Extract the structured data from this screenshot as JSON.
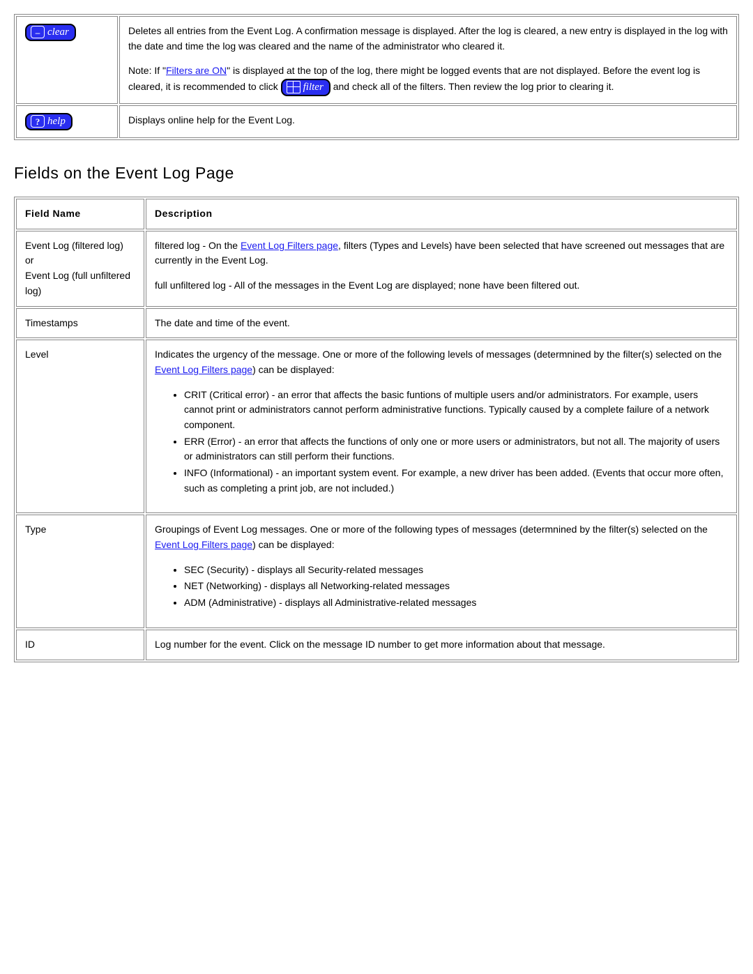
{
  "buttons_table": {
    "rows": [
      {
        "btn": {
          "lead": "–",
          "label": "clear",
          "name": "clear-button"
        },
        "desc_para1": "Deletes all entries from the Event Log. A confirmation message is displayed. After the log is cleared, a new entry is displayed in the log with the date and time the log was cleared and the name of the administrator who cleared it.",
        "note_prefix": "Note: If \"",
        "note_link": "Filters are ON",
        "note_mid": "\" is displayed at the top of the log, there might be logged events that are not displayed. Before the event log is cleared, it is recommended to click ",
        "filter_btn": {
          "label": "filter"
        },
        "note_suffix": " and check all of the filters. Then review the log prior to clearing it."
      },
      {
        "btn": {
          "lead": "?",
          "label": "help",
          "name": "help-button"
        },
        "desc_para1": "Displays online help for the Event Log."
      }
    ]
  },
  "section_heading": "Fields on the Event Log Page",
  "fields_table": {
    "head": {
      "name": "Field Name",
      "desc": "Description"
    },
    "rows": [
      {
        "name_html": "Event Log (filtered log)<br>or<br>Event Log (full unfiltered log)",
        "desc": {
          "p1_pre": "filtered log - On the ",
          "p1_link": "Event Log Filters page",
          "p1_post": ", filters (Types and Levels) have been selected that have screened out messages that are currently in the Event Log.",
          "p2": "full unfiltered log - All of the messages in the Event Log are displayed; none have been filtered out."
        }
      },
      {
        "name": "Timestamps",
        "desc_plain": "The date and time of the event."
      },
      {
        "name": "Level",
        "desc": {
          "intro_pre": "Indicates the urgency of the message. One or more of the following levels of messages (determnined by the filter(s) selected on the ",
          "intro_link": "Event Log Filters page",
          "intro_post": ") can be displayed:",
          "bullets": [
            "CRIT (Critical error) - an error that affects the basic funtions of multiple users and/or administrators. For example, users cannot print or administrators cannot perform administrative functions. Typically caused by a complete failure of a network component.",
            "ERR (Error) - an error that affects the functions of only one or more users or administrators, but not all. The majority of users or administrators can still perform their functions.",
            "INFO (Informational) - an important system event. For example, a new driver has been added. (Events that occur more often, such as completing a print job, are not included.)"
          ]
        }
      },
      {
        "name": "Type",
        "desc": {
          "intro_pre": "Groupings of Event Log messages. One or more of the following types of messages (determnined by the filter(s) selected on the ",
          "intro_link": "Event Log Filters page",
          "intro_post": ") can be displayed:",
          "bullets": [
            "SEC (Security) - displays all Security-related messages",
            "NET (Networking) - displays all Networking-related messages",
            "ADM (Administrative) - displays all Administrative-related messages"
          ]
        }
      },
      {
        "name": "ID",
        "desc_plain": "Log number for the event. Click on the message ID number to get more information about that message."
      }
    ]
  }
}
